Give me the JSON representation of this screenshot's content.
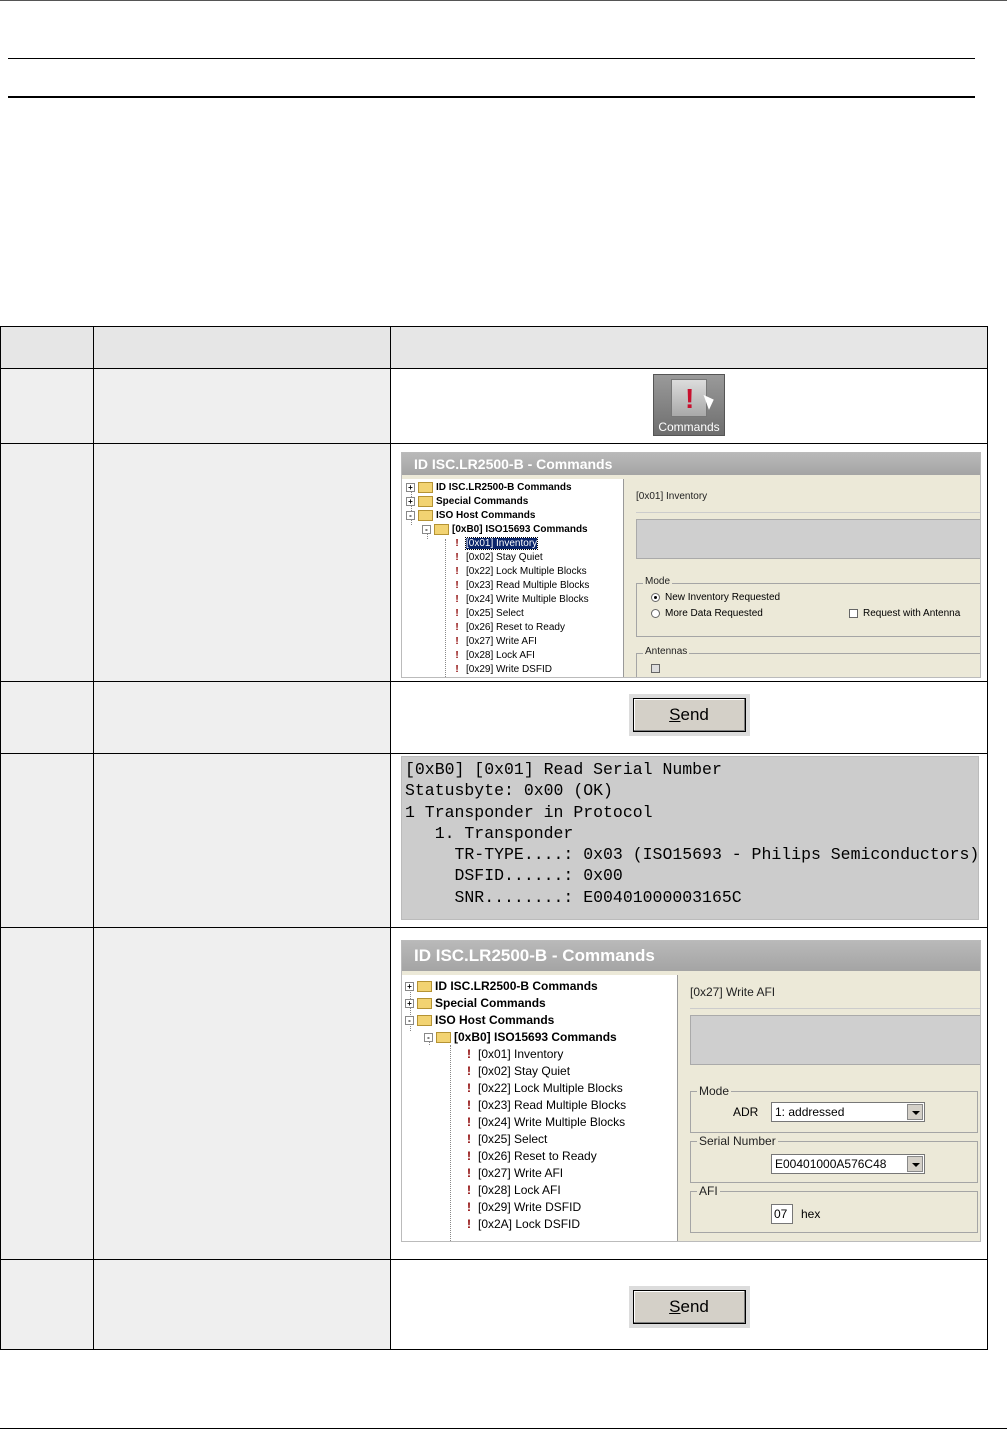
{
  "table": {
    "headers": [
      "",
      "",
      ""
    ],
    "rows": [
      {
        "icon_label": "Commands"
      },
      {
        "window_title": "ID ISC.LR2500-B - Commands",
        "tree": [
          "ID ISC.LR2500-B Commands",
          "Special Commands",
          "ISO Host Commands",
          "[0xB0] ISO15693 Commands",
          "[0x01] Inventory",
          "[0x02] Stay Quiet",
          "[0x22] Lock Multiple Blocks",
          "[0x23] Read Multiple Blocks",
          "[0x24] Write Multiple Blocks",
          "[0x25] Select",
          "[0x26] Reset to Ready",
          "[0x27] Write AFI",
          "[0x28] Lock AFI",
          "[0x29] Write DSFID"
        ],
        "command_name": "[0x01] Inventory",
        "mode_label": "Mode",
        "radio_new": "New Inventory Requested",
        "radio_more": "More Data Requested",
        "checkbox_antenna": "Request with Antenna",
        "antennas_label": "Antennas"
      },
      {
        "send_prefix": "S",
        "send_rest": "end"
      },
      {
        "console_lines": [
          "[0xB0] [0x01] Read Serial Number",
          "Statusbyte: 0x00 (OK)",
          "1 Transponder in Protocol",
          "   1. Transponder",
          "     TR-TYPE....: 0x03 (ISO15693 - Philips Semiconductors)",
          "     DSFID......: 0x00",
          "     SNR........: E00401000003165C"
        ]
      },
      {
        "window_title": "ID ISC.LR2500-B - Commands",
        "tree": [
          "ID ISC.LR2500-B Commands",
          "Special Commands",
          "ISO Host Commands",
          "[0xB0] ISO15693 Commands",
          "[0x01] Inventory",
          "[0x02] Stay Quiet",
          "[0x22] Lock Multiple Blocks",
          "[0x23] Read Multiple Blocks",
          "[0x24] Write Multiple Blocks",
          "[0x25] Select",
          "[0x26] Reset to Ready",
          "[0x27] Write AFI",
          "[0x28] Lock AFI",
          "[0x29] Write DSFID",
          "[0x2A] Lock DSFID"
        ],
        "command_name": "[0x27] Write AFI",
        "mode_label": "Mode",
        "adr_label": "ADR",
        "adr_value": "1: addressed",
        "serial_label": "Serial Number",
        "serial_value": "E00401000A576C48",
        "afi_label": "AFI",
        "afi_value": "07",
        "afi_unit": "hex"
      },
      {
        "send_prefix": "S",
        "send_rest": "end"
      }
    ]
  }
}
